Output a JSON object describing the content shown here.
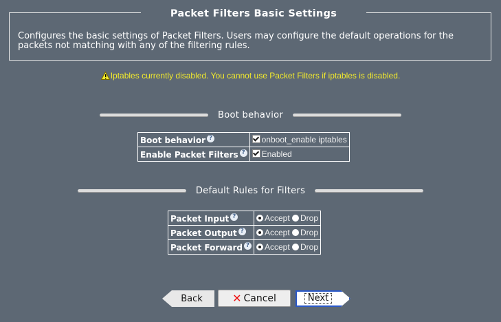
{
  "header": {
    "title": "Packet Filters Basic Settings",
    "description": "Configures the basic settings of Packet Filters. Users may configure the default operations for the packets not matching with any of the filtering rules."
  },
  "warning": {
    "icon": "warning-icon",
    "text": "Iptables currently disabled. You cannot use Packet Filters if iptables is disabled."
  },
  "boot_section": {
    "title": "Boot behavior",
    "rows": [
      {
        "label": "Boot behavior",
        "value": "onboot_enable iptables",
        "checked": true
      },
      {
        "label": "Enable Packet Filters",
        "value": "Enabled",
        "checked": true
      }
    ]
  },
  "rules_section": {
    "title": "Default Rules for Filters",
    "accept_label": "Accept",
    "drop_label": "Drop",
    "rows": [
      {
        "label": "Packet Input",
        "selected": "Accept"
      },
      {
        "label": "Packet Output",
        "selected": "Accept"
      },
      {
        "label": "Packet Forward",
        "selected": "Accept"
      }
    ]
  },
  "help_glyph": "?",
  "buttons": {
    "back": "Back",
    "cancel": "Cancel",
    "cancel_glyph": "✕",
    "next": "Next"
  },
  "colors": {
    "background": "#5d6874",
    "warning": "#f2ea2c",
    "focus": "#2a58c8"
  }
}
